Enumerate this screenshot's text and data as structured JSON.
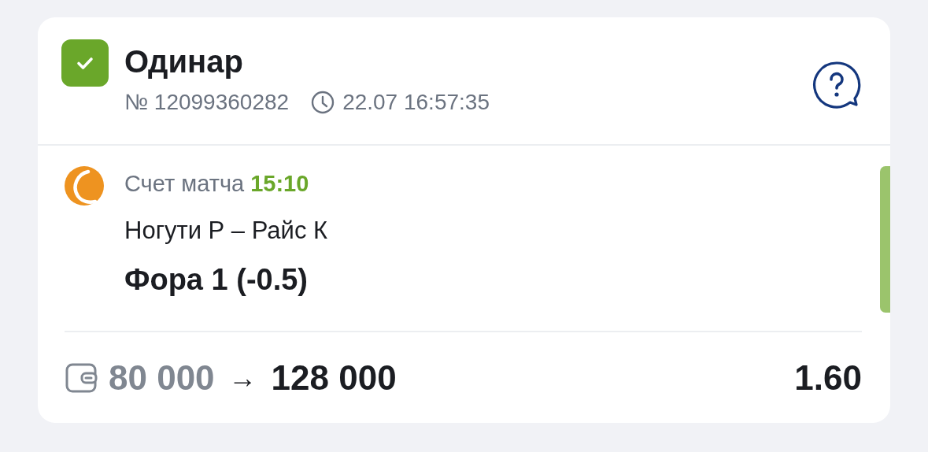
{
  "bet": {
    "type": "Одинар",
    "won": true,
    "number": "№ 12099360282",
    "time": "22.07 16:57:35"
  },
  "event": {
    "score_label": "Счет матча",
    "score": "15:10",
    "teams": "Ногути Р – Райс К",
    "market": "Фора 1 (-0.5)"
  },
  "summary": {
    "stake": "80 000",
    "arrow": "→",
    "payout": "128 000",
    "odds": "1.60"
  }
}
